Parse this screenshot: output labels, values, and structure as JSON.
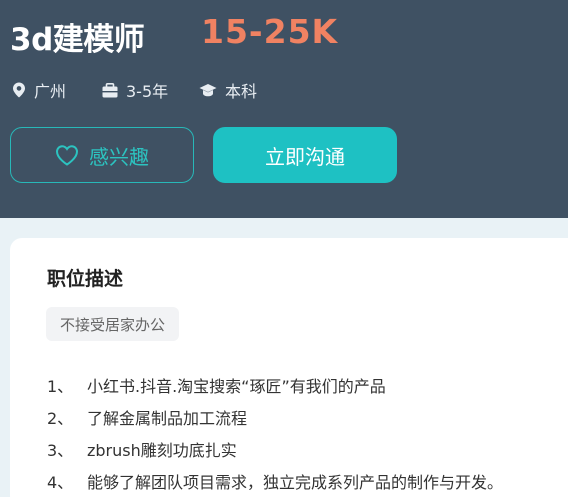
{
  "job": {
    "title": "3d建模师",
    "salary": "15-25K",
    "city": "广州",
    "experience": "3-5年",
    "education": "本科"
  },
  "actions": {
    "interest_label": "感兴趣",
    "chat_label": "立即沟通"
  },
  "description": {
    "heading": "职位描述",
    "tag": "不接受居家办公",
    "items": [
      {
        "num": "1、",
        "text": "小红书.抖音.淘宝搜索“琢匠”有我们的产品"
      },
      {
        "num": "2、",
        "text": "了解金属制品加工流程"
      },
      {
        "num": "3、",
        "text": "zbrush雕刻功底扎实"
      },
      {
        "num": "4、",
        "text": "能够了解团队项目需求，独立完成系列产品的制作与开发。"
      }
    ]
  },
  "colors": {
    "header_bg": "#3f5163",
    "salary": "#f08262",
    "accent": "#1ec1c3"
  },
  "icons": [
    "location-pin-icon",
    "briefcase-icon",
    "graduation-cap-icon",
    "heart-outline-icon"
  ]
}
